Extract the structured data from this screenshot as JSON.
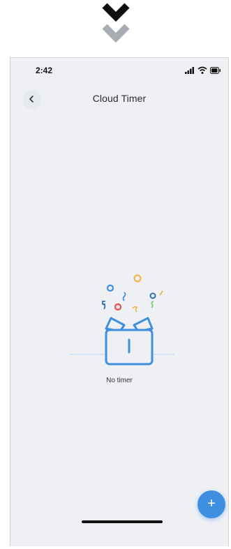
{
  "status_bar": {
    "time": "2:42",
    "icons": [
      "signal-icon",
      "wifi-icon",
      "battery-icon"
    ]
  },
  "header": {
    "title": "Cloud Timer",
    "back_icon": "chevron-left-icon"
  },
  "empty_state": {
    "message": "No timer",
    "illustration": "gift-box-icon"
  },
  "fab": {
    "label": "+",
    "color": "#3f8fe0"
  },
  "decor": {
    "top_chevrons_icon": "double-chevron-down-icon"
  },
  "colors": {
    "accent": "#3f8fe0",
    "background": "#eef0f3"
  }
}
